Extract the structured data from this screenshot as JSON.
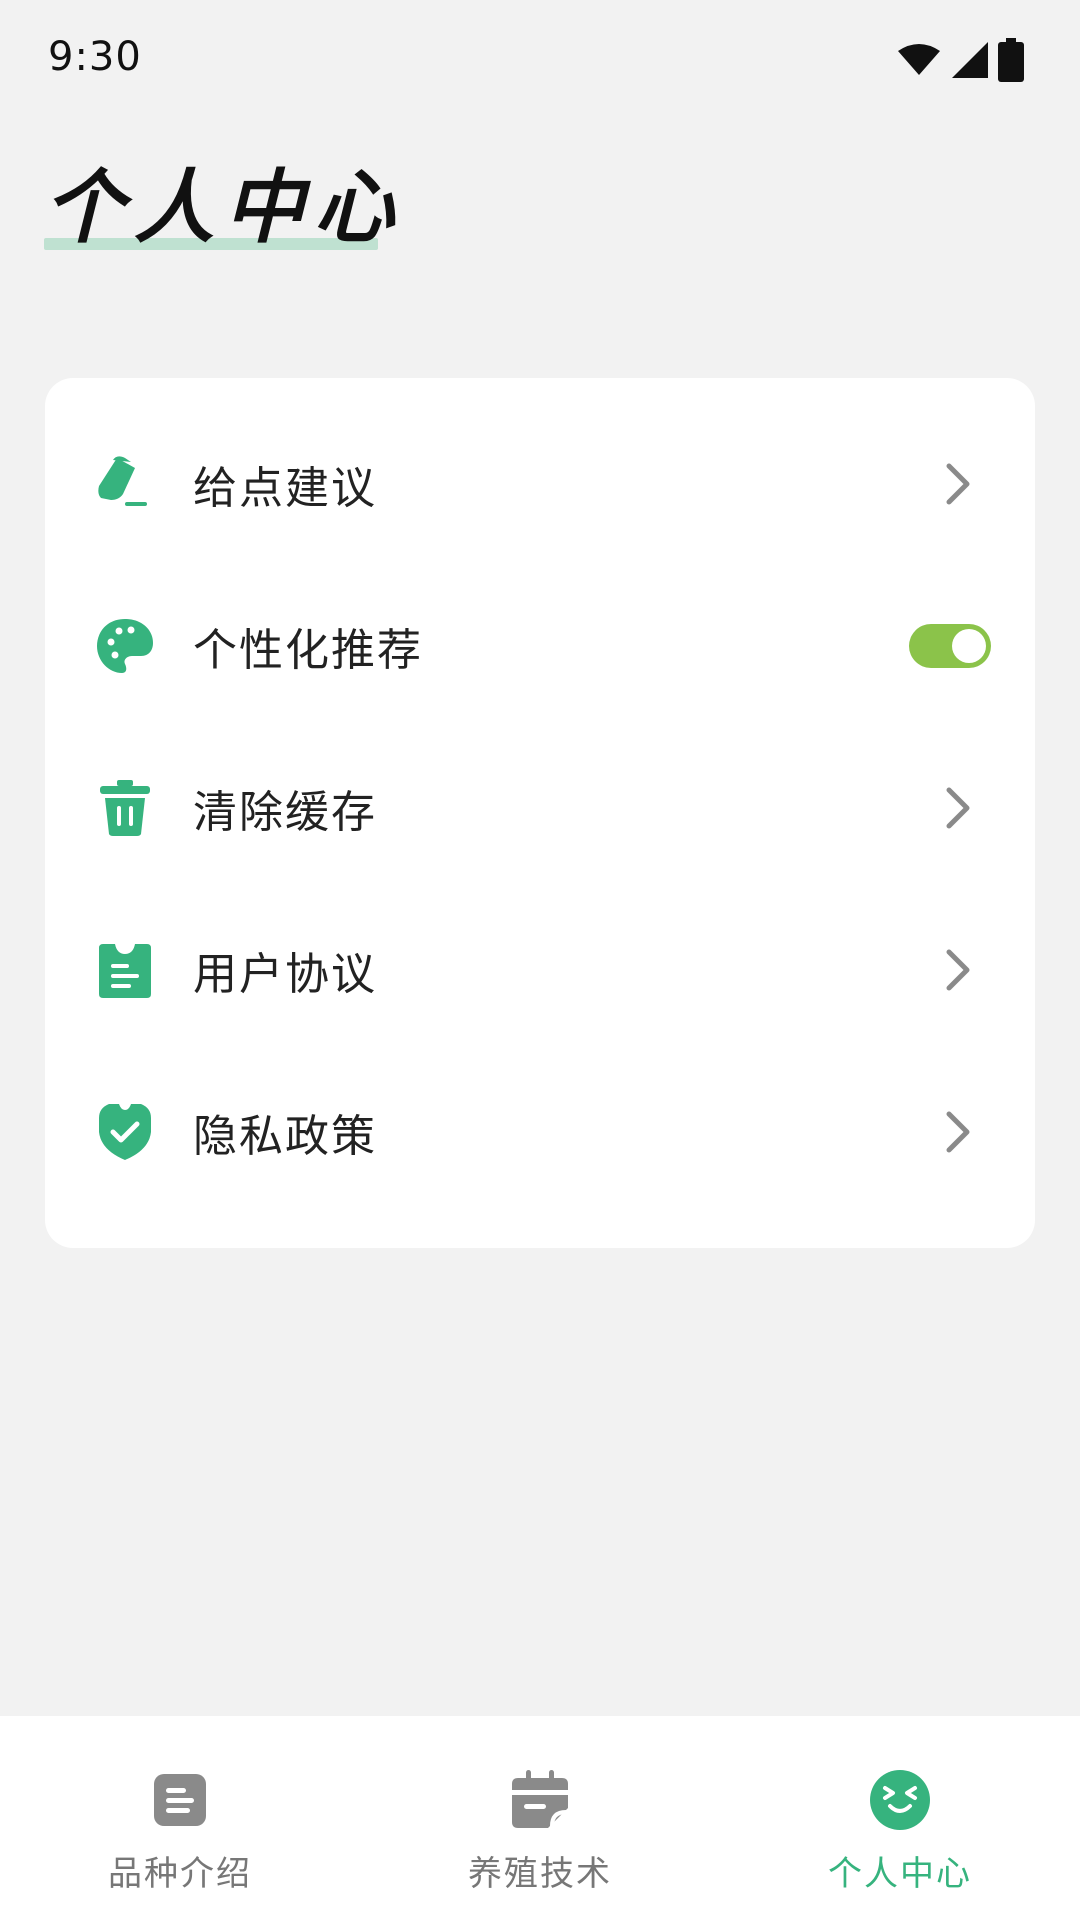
{
  "status_bar": {
    "time": "9:30"
  },
  "header": {
    "title": "个人中心"
  },
  "menu": {
    "items": [
      {
        "label": "给点建议",
        "icon": "edit-icon",
        "trailing": "chevron"
      },
      {
        "label": "个性化推荐",
        "icon": "palette-icon",
        "trailing": "toggle",
        "toggle_on": true
      },
      {
        "label": "清除缓存",
        "icon": "trash-icon",
        "trailing": "chevron"
      },
      {
        "label": "用户协议",
        "icon": "document-icon",
        "trailing": "chevron"
      },
      {
        "label": "隐私政策",
        "icon": "shield-check-icon",
        "trailing": "chevron"
      }
    ]
  },
  "bottom_nav": {
    "items": [
      {
        "label": "品种介绍",
        "icon": "list-doc-icon",
        "active": false
      },
      {
        "label": "养殖技术",
        "icon": "calendar-icon",
        "active": false
      },
      {
        "label": "个人中心",
        "icon": "smile-icon",
        "active": true
      }
    ]
  },
  "colors": {
    "accent": "#36b37e",
    "toggle": "#8bc34a",
    "inactive": "#777777",
    "background": "#f2f2f2"
  }
}
